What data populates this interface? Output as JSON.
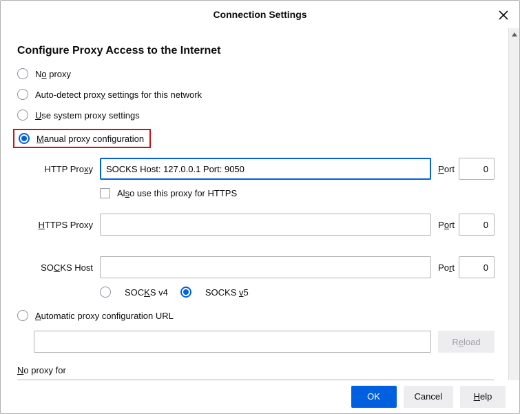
{
  "title": "Connection Settings",
  "section_title": "Configure Proxy Access to the Internet",
  "mode": {
    "no_proxy": {
      "label_html": "N<u>o</u> proxy",
      "selected": false
    },
    "auto_detect": {
      "label_html": "Auto-detect prox<u>y</u> settings for this network",
      "selected": false
    },
    "system": {
      "label_html": "<u>U</u>se system proxy settings",
      "selected": false
    },
    "manual": {
      "label_html": "<u>M</u>anual proxy configuration",
      "selected": true
    },
    "pac": {
      "label_html": "<u>A</u>utomatic proxy configuration URL",
      "selected": false
    }
  },
  "http": {
    "label_html": "HTTP Pro<u>x</u>y",
    "value": "SOCKS Host: 127.0.0.1 Port: 9050",
    "port_label_html": "<u>P</u>ort",
    "port": "0"
  },
  "also_https": {
    "label_html": "Al<u>s</u>o use this proxy for HTTPS",
    "checked": false
  },
  "https": {
    "label_html": "<u>H</u>TTPS Proxy",
    "value": "",
    "port_label_html": "P<u>o</u>rt",
    "port": "0"
  },
  "socks": {
    "label_html": "SO<u>C</u>KS Host",
    "value": "",
    "port_label_html": "Po<u>r</u>t",
    "port": "0",
    "v4_label_html": "SOC<u>K</u>S v4",
    "v5_label_html": "SOCKS <u>v</u>5",
    "v5_selected": true
  },
  "pac_url": {
    "value": "",
    "reload_label_html": "R<u>e</u>load"
  },
  "no_proxy_for": {
    "label_html": "<u>N</u>o proxy for",
    "value": ""
  },
  "buttons": {
    "ok": "OK",
    "cancel": "Cancel",
    "help_html": "<u>H</u>elp"
  }
}
